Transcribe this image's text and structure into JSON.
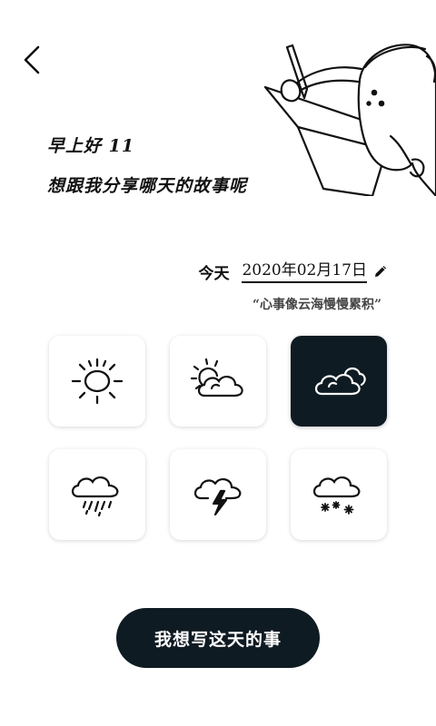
{
  "header": {
    "greeting_line1": "早上好  11",
    "greeting_line2": "想跟我分享哪天的故事呢"
  },
  "date": {
    "label": "今天",
    "value": "2020年02月17日"
  },
  "quote": "“心事像云海慢慢累积”",
  "weather_options": [
    {
      "icon": "sun-icon",
      "selected": false
    },
    {
      "icon": "partly-cloudy-icon",
      "selected": false
    },
    {
      "icon": "cloudy-icon",
      "selected": true
    },
    {
      "icon": "rain-icon",
      "selected": false
    },
    {
      "icon": "thunderstorm-icon",
      "selected": false
    },
    {
      "icon": "snow-icon",
      "selected": false
    }
  ],
  "cta": {
    "label": "我想写这天的事"
  },
  "colors": {
    "dark": "#0f1b22",
    "text": "#111111",
    "quote": "#444444",
    "background": "#ffffff"
  }
}
